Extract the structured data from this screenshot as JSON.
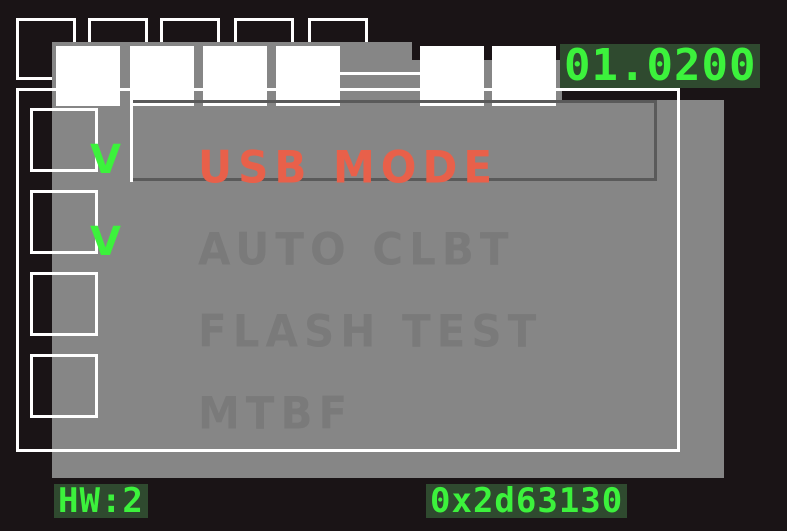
{
  "top_right_readout": "01.0200",
  "menu": {
    "items": [
      {
        "label": "USB MODE",
        "checked": true,
        "active": true
      },
      {
        "label": "AUTO CLBT",
        "checked": true,
        "active": false
      },
      {
        "label": "FLASH TEST",
        "checked": false,
        "active": false
      },
      {
        "label": "MTBF",
        "checked": false,
        "active": false
      }
    ],
    "check_glyph": "V"
  },
  "footer": {
    "hw_label": "HW:2",
    "hex_code": "0x2d63130"
  },
  "colors": {
    "background": "#1a1416",
    "panel": "#868686",
    "highlight": "#e8604a",
    "readout_text": "#3cf23c",
    "menu_text": "#7a7a7a"
  }
}
